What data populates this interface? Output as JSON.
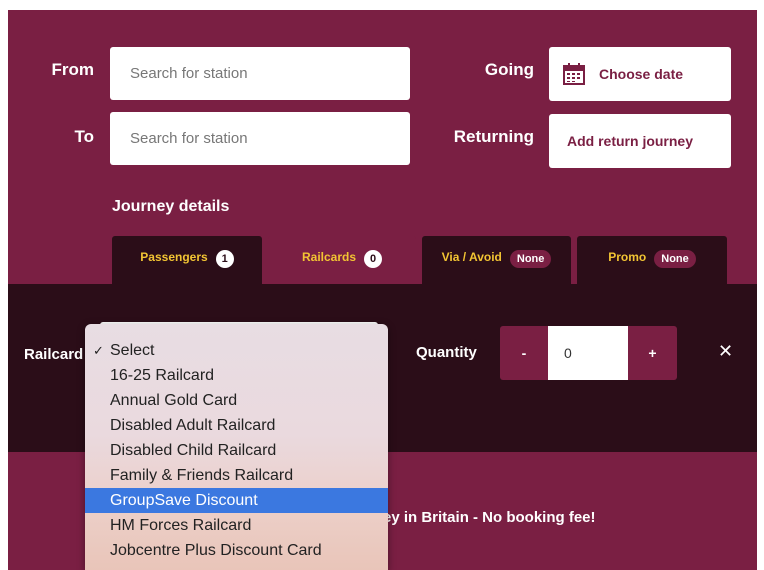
{
  "form": {
    "from_label": "From",
    "from_placeholder": "Search for station",
    "to_label": "To",
    "to_placeholder": "Search for station",
    "going_label": "Going",
    "going_value": "Choose date",
    "returning_label": "Returning",
    "returning_value": "Add return journey"
  },
  "journey_details": {
    "title": "Journey details",
    "tabs": [
      {
        "label": "Passengers",
        "badge": "1"
      },
      {
        "label": "Railcards",
        "badge": "0"
      },
      {
        "label": "Via / Avoid",
        "badge": "None"
      },
      {
        "label": "Promo",
        "badge": "None"
      }
    ],
    "active_tab": "Railcards"
  },
  "railcard_drawer": {
    "railcard_label": "Railcard",
    "quantity_label": "Quantity",
    "minus_label": "-",
    "plus_label": "+",
    "quantity_value": "0",
    "close_label": "✕"
  },
  "railcard_dropdown": {
    "options": [
      "Select",
      "16-25 Railcard",
      "Annual Gold Card",
      "Disabled Adult Railcard",
      "Disabled Child Railcard",
      "Family & Friends Railcard",
      "GroupSave Discount",
      "HM Forces Railcard",
      "Jobcentre Plus Discount Card"
    ],
    "checked": "Select",
    "highlighted": "GroupSave Discount"
  },
  "footer": {
    "message": "rney in Britain - No booking fee!"
  },
  "colors": {
    "brand": "#7a1f43",
    "dark": "#2b0d18",
    "accent": "#f2c433",
    "highlight": "#3b78e0"
  },
  "icons": {
    "calendar": "calendar-icon",
    "close": "close-icon"
  }
}
